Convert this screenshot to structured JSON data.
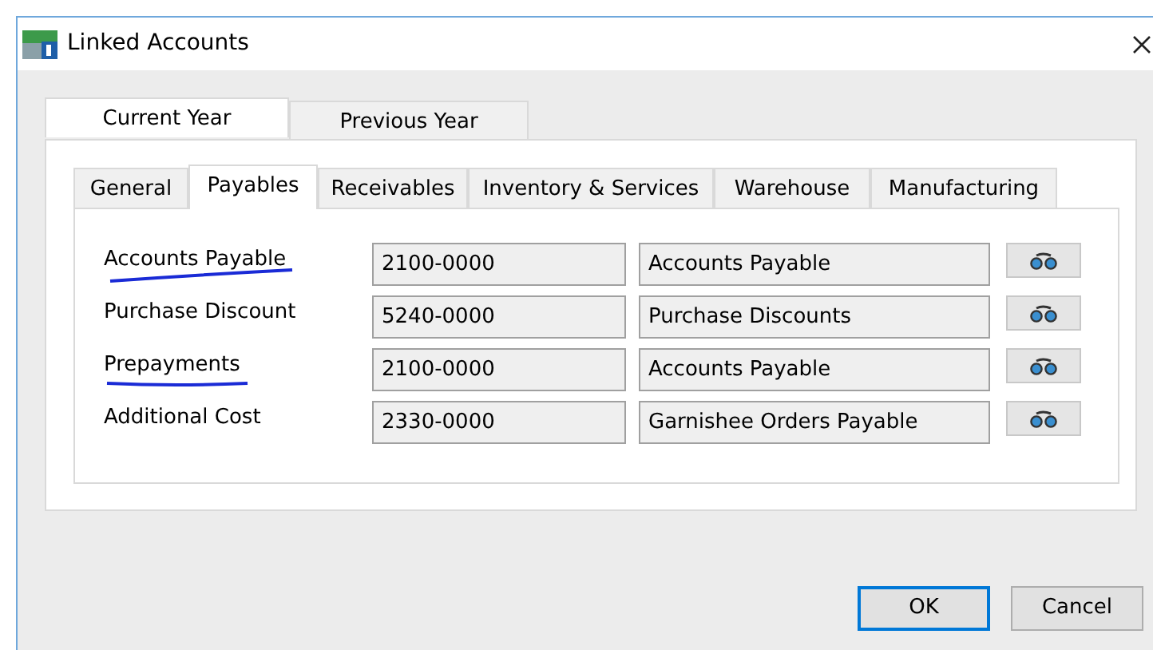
{
  "window": {
    "title": "Linked Accounts"
  },
  "year_tabs": [
    {
      "label": "Current Year",
      "selected": true
    },
    {
      "label": "Previous Year",
      "selected": false
    }
  ],
  "section_tabs": [
    {
      "label": "General",
      "selected": false
    },
    {
      "label": "Payables",
      "selected": true
    },
    {
      "label": "Receivables",
      "selected": false
    },
    {
      "label": "Inventory & Services",
      "selected": false
    },
    {
      "label": "Warehouse",
      "selected": false
    },
    {
      "label": "Manufacturing",
      "selected": false
    }
  ],
  "rows": [
    {
      "label": "Accounts Payable",
      "account": "2100-0000",
      "name": "Accounts Payable",
      "underlined": true
    },
    {
      "label": "Purchase Discount",
      "account": "5240-0000",
      "name": "Purchase Discounts",
      "underlined": false
    },
    {
      "label": "Prepayments",
      "account": "2100-0000",
      "name": "Accounts Payable",
      "underlined": true
    },
    {
      "label": "Additional Cost",
      "account": "2330-0000",
      "name": "Garnishee Orders Payable",
      "underlined": false
    }
  ],
  "buttons": [
    {
      "label": "OK",
      "focused": true
    },
    {
      "label": "Cancel",
      "focused": false
    }
  ]
}
